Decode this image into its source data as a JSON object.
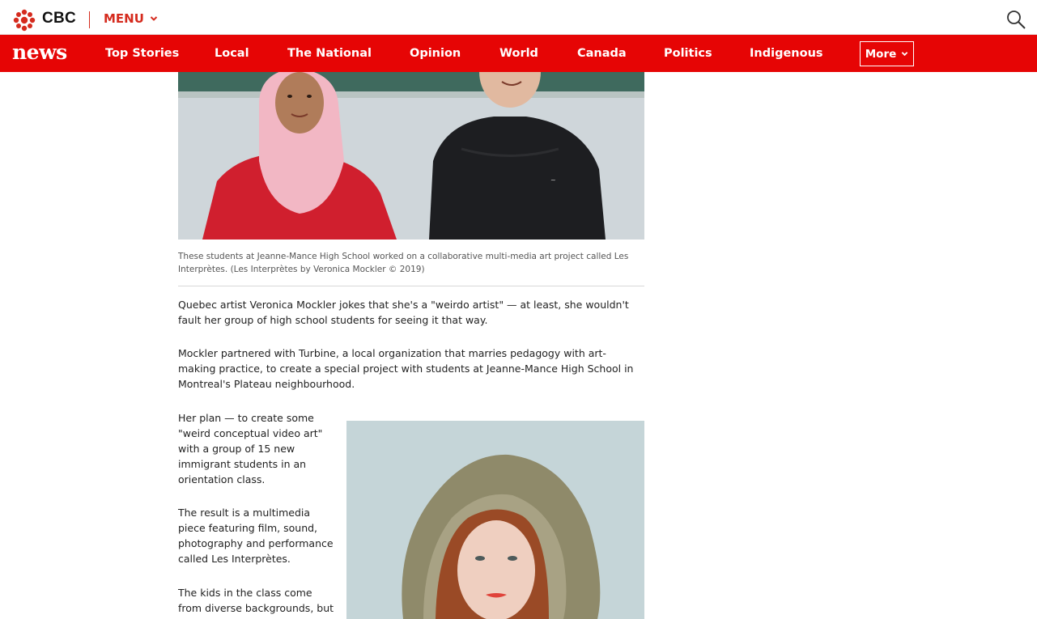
{
  "header": {
    "brand": "CBC",
    "menu_label": "MENU"
  },
  "nav": {
    "logo": "news",
    "items": [
      {
        "label": "Top Stories"
      },
      {
        "label": "Local"
      },
      {
        "label": "The National"
      },
      {
        "label": "Opinion"
      },
      {
        "label": "World"
      },
      {
        "label": "Canada"
      },
      {
        "label": "Politics"
      },
      {
        "label": "Indigenous"
      }
    ],
    "more_label": "More"
  },
  "article": {
    "caption": "These students at Jeanne-Mance High School worked on a collaborative multi-media art project called Les Interprètes. (Les Interprètes by Veronica Mockler © 2019)",
    "paragraphs": [
      "Quebec artist Veronica Mockler jokes that she's a \"weirdo artist\" — at least, she wouldn't fault her group of high school students for seeing it that way.",
      "Mockler partnered with Turbine, a local organization that marries pedagogy with art-making practice, to create a special project with students at Jeanne-Mance High School in Montreal's Plateau neighbourhood.",
      "Her plan — to create some \"weird conceptual video art\" with a group of 15 new immigrant students in an orientation class.",
      "The result is a multimedia piece featuring film, sound, photography and performance called Les Interprètes.",
      "The kids in the class come from diverse backgrounds, but they"
    ]
  },
  "colors": {
    "brand_red": "#e60505",
    "cbc_red": "#d52b1e"
  },
  "icons": [
    "cbc-gem-icon",
    "chevron-down-icon",
    "search-icon"
  ]
}
